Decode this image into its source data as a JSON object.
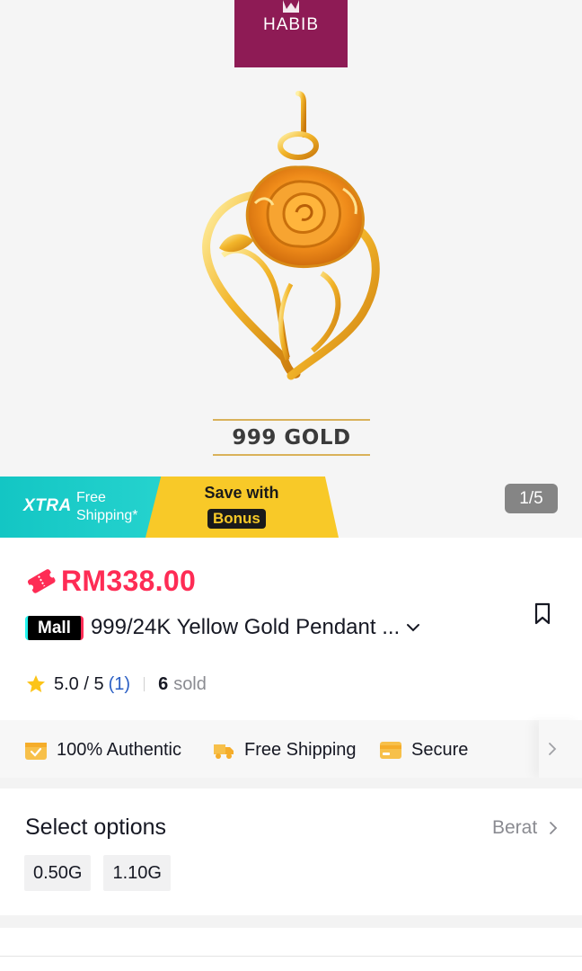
{
  "hero": {
    "brand": "HABIB",
    "gold_label": "999 GOLD",
    "image_counter": "1/5",
    "image_alt": "gold rose heart pendant"
  },
  "promo": {
    "xtra_logo": "XTRA",
    "xtra_line1": "Free",
    "xtra_line2": "Shipping*",
    "save_text": "Save with",
    "bonus": "Bonus",
    "xtra_color": "#13c6c4",
    "save_color": "#f8c928"
  },
  "product": {
    "price": "RM338.00",
    "price_color": "#fe2c55",
    "mall_badge": "Mall",
    "title": "999/24K Yellow Gold Pendant ...",
    "rating": "5.0 / 5",
    "rating_count": "(1)",
    "sold_count": "6",
    "sold_label": "sold"
  },
  "benefits": [
    {
      "label": "100% Authentic",
      "icon": "authentic-box-icon"
    },
    {
      "label": "Free Shipping",
      "icon": "delivery-truck-icon"
    },
    {
      "label": "Secure",
      "icon": "secure-card-icon"
    }
  ],
  "options": {
    "title": "Select options",
    "hint": "Berat",
    "chips": [
      "0.50G",
      "1.10G"
    ]
  }
}
